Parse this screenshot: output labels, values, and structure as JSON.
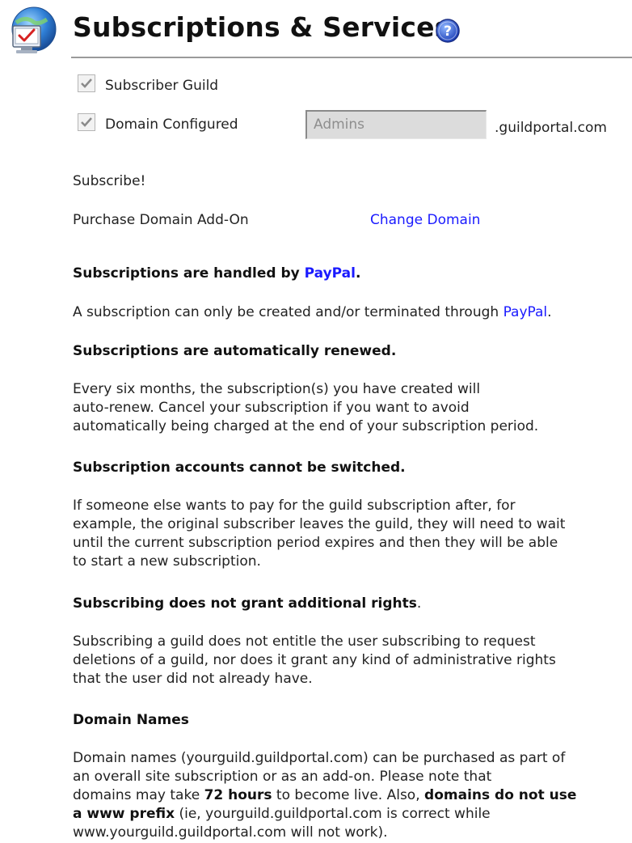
{
  "header": {
    "title": "Subscriptions & Services",
    "icon": "subscriptions-computer-icon",
    "help_icon": "help-icon"
  },
  "options": {
    "subscriber_guild": {
      "label": "Subscriber Guild",
      "checked": true
    },
    "domain_configured": {
      "label": "Domain Configured",
      "checked": true
    },
    "domain_input_value": "Admins",
    "domain_suffix": ".guildportal.com"
  },
  "links": {
    "subscribe": "Subscribe!",
    "purchase_domain": "Purchase Domain Add-On",
    "change_domain": "Change Domain"
  },
  "sections": {
    "paypal": {
      "heading_prefix": "Subscriptions are handled by ",
      "heading_link": "PayPal",
      "heading_suffix": ".",
      "body_prefix": "A subscription can only be created and/or terminated through ",
      "body_link": "PayPal",
      "body_suffix": "."
    },
    "renewal": {
      "heading": "Subscriptions are automatically renewed.",
      "lines": [
        "Every six months, the subscription(s) you have created will",
        "auto-renew.  Cancel your subscription if you want to avoid",
        "automatically being charged at the end of your subscription period."
      ]
    },
    "switching": {
      "heading": "Subscription accounts cannot be switched.",
      "lines": [
        "If someone else wants to pay for the guild subscription after, for",
        "example, the original subscriber leaves the guild, they will need to wait",
        "until the current subscription period expires and then they will be able",
        "to start a new subscription."
      ]
    },
    "rights": {
      "heading_bold": "Subscribing does not grant additional rights",
      "heading_suffix": ".",
      "lines": [
        "Subscribing a guild does not entitle the user subscribing to request",
        "deletions of a guild, nor does it grant any kind of administrative rights",
        "that the user did not already have."
      ]
    },
    "domains": {
      "heading": "Domain Names",
      "line1": "Domain names (yourguild.guildportal.com) can be purchased as part of",
      "line2": "an overall site subscription or as an add-on.  Please note that",
      "line3_a": "domains may take ",
      "line3_b": "72 hours",
      "line3_c": " to become live.  Also, ",
      "line3_d": "domains do not use",
      "line4_a": "a www prefix",
      "line4_b": " (ie, yourguild.guildportal.com is correct while",
      "line5": "www.yourguild.guildportal.com will not work)."
    }
  }
}
